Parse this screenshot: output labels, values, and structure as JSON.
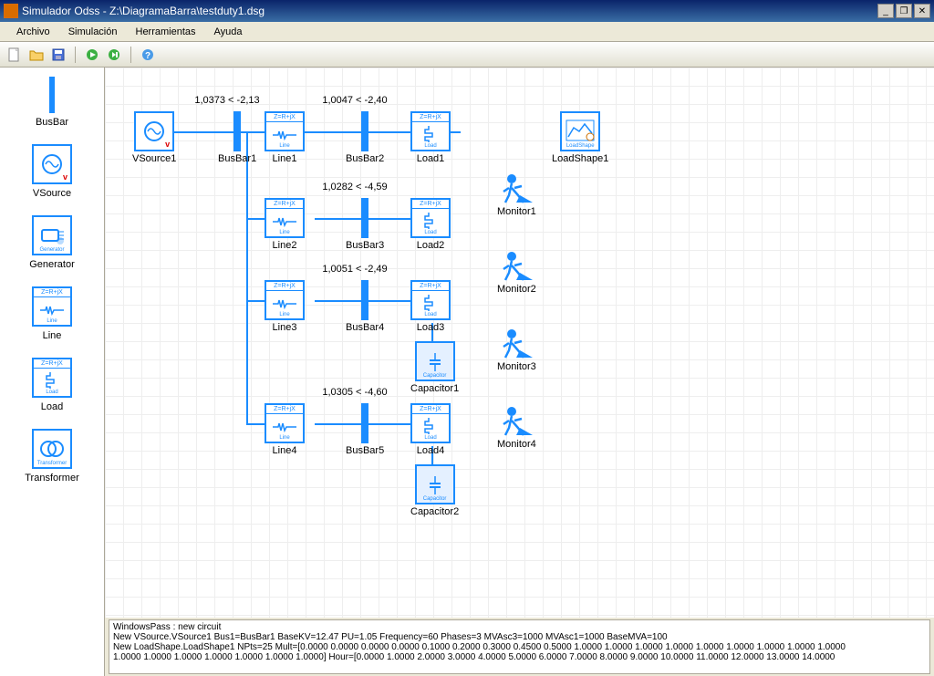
{
  "window": {
    "title": "Simulador Odss - Z:\\DiagramaBarra\\testduty1.dsg"
  },
  "menu": {
    "archivo": "Archivo",
    "simulacion": "Simulación",
    "herramientas": "Herramientas",
    "ayuda": "Ayuda"
  },
  "palette": {
    "busbar": "BusBar",
    "vsource": "VSource",
    "generator": "Generator",
    "line": "Line",
    "load": "Load",
    "transformer": "Transformer"
  },
  "busValues": {
    "bus1": "1,0373 < -2,13",
    "bus2": "1,0047 < -2,40",
    "bus3": "1,0282 < -4,59",
    "bus4": "1,0051 < -2,49",
    "bus5": "1,0305 < -4,60"
  },
  "nodes": {
    "vsource1": "VSource1",
    "busbar1": "BusBar1",
    "line1": "Line1",
    "busbar2": "BusBar2",
    "load1": "Load1",
    "line2": "Line2",
    "busbar3": "BusBar3",
    "load2": "Load2",
    "line3": "Line3",
    "busbar4": "BusBar4",
    "load3": "Load3",
    "capacitor1": "Capacitor1",
    "line4": "Line4",
    "busbar5": "BusBar5",
    "load4": "Load4",
    "capacitor2": "Capacitor2",
    "loadshape1": "LoadShape1",
    "monitor1": "Monitor1",
    "monitor2": "Monitor2",
    "monitor3": "Monitor3",
    "monitor4": "Monitor4"
  },
  "iconText": {
    "zrjx": "Z=R+jX",
    "line_sub": "Line",
    "load_sub": "Load",
    "cap_sub": "Capacitor",
    "gen_sub": "Generator",
    "xfmr_sub": "Transformer",
    "ls_sub": "LoadShape"
  },
  "log": {
    "l1": "WindowsPass : new circuit",
    "l2": "New VSource.VSource1 Bus1=BusBar1 BaseKV=12.47 PU=1.05 Frequency=60 Phases=3 MVAsc3=1000 MVAsc1=1000 BaseMVA=100",
    "l3": "New LoadShape.LoadShape1 NPts=25 Mult=[0.0000 0.0000 0.0000 0.0000 0.1000 0.2000 0.3000 0.4500 0.5000 1.0000 1.0000 1.0000 1.0000 1.0000 1.0000 1.0000 1.0000 1.0000",
    "l4": "1.0000 1.0000 1.0000 1.0000 1.0000 1.0000 1.0000] Hour=[0.0000 1.0000 2.0000 3.0000 4.0000 5.0000 6.0000 7.0000 8.0000 9.0000 10.0000 11.0000 12.0000 13.0000 14.0000"
  }
}
